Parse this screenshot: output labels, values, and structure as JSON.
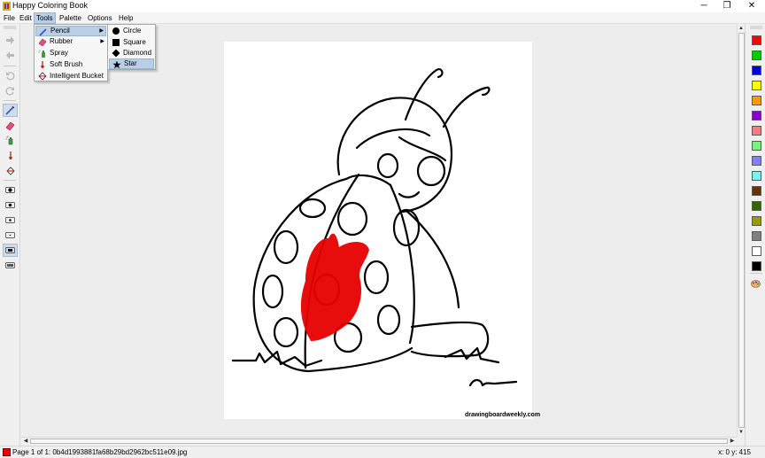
{
  "window": {
    "title": "Happy Coloring Book",
    "minimize": "─",
    "restore": "❐",
    "close": "✕"
  },
  "menubar": {
    "items": [
      "File",
      "Edit",
      "Tools",
      "Palette",
      "Options",
      "Help"
    ]
  },
  "tools_menu": {
    "items": [
      "Pencil",
      "Rubber",
      "Spray",
      "Soft Brush",
      "Intelligent Bucket"
    ]
  },
  "pencil_submenu": {
    "items": [
      "Circle",
      "Square",
      "Diamond",
      "Star"
    ],
    "selected": "Star"
  },
  "canvas": {
    "watermark": "drawingboardweekly.com"
  },
  "palette": {
    "colors": [
      "#ff0000",
      "#00cc00",
      "#0000dd",
      "#ffff00",
      "#ff9900",
      "#8800cc",
      "#f08080",
      "#80ee80",
      "#8080ee",
      "#80eeee",
      "#663300",
      "#336600",
      "#999900",
      "#808080",
      "#ffffff",
      "#000000"
    ]
  },
  "status": {
    "current_color": "#ee0000",
    "text": "Page 1 of 1: 0b4d1993881fa68b29bd2962bc511e09.jpg",
    "coords": "x: 0 y: 415"
  }
}
